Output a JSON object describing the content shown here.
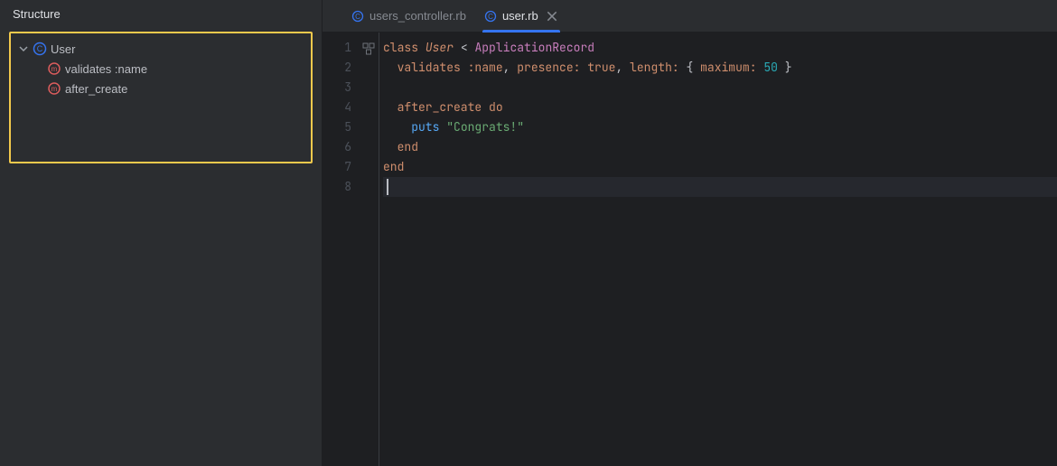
{
  "sidebar": {
    "title": "Structure",
    "items": [
      {
        "label": "User",
        "icon": "class-icon"
      },
      {
        "label": "validates :name",
        "icon": "method-icon"
      },
      {
        "label": "after_create",
        "icon": "method-icon"
      }
    ]
  },
  "tabs": [
    {
      "label": "users_controller.rb",
      "active": false,
      "icon": "ruby-class-icon"
    },
    {
      "label": "user.rb",
      "active": true,
      "icon": "ruby-class-icon"
    }
  ],
  "code": {
    "line1": {
      "class": "class",
      "user": "User",
      "op": " < ",
      "parent": "ApplicationRecord"
    },
    "line2": {
      "method": "validates",
      "sym": " :name",
      "p1": ", ",
      "k1": "presence:",
      "sp1": " ",
      "true": "true",
      "p2": ", ",
      "k2": "length:",
      "sp2": " ",
      "b1": "{ ",
      "k3": "maximum:",
      "sp3": " ",
      "num": "50",
      "b2": " }"
    },
    "line3": "",
    "line4": {
      "method": "after_create",
      "do": " do"
    },
    "line5": {
      "puts": "puts",
      "sp": " ",
      "str": "\"Congrats!\""
    },
    "line6": {
      "end": "end"
    },
    "line7": {
      "end": "end"
    },
    "line8": ""
  },
  "lineNumbers": [
    "1",
    "2",
    "3",
    "4",
    "5",
    "6",
    "7",
    "8"
  ]
}
